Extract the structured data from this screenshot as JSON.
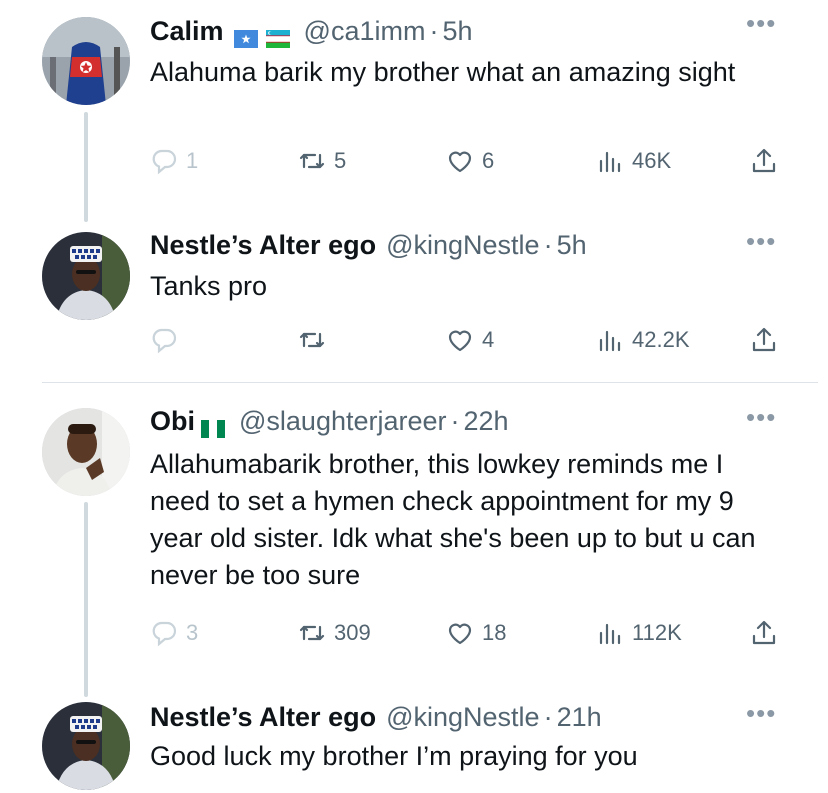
{
  "tweets": [
    {
      "name": "Calim",
      "handle": "@ca1imm",
      "sep": "·",
      "time": "5h",
      "text": "Alahuma barik my brother what an amazing sight",
      "replies": "1",
      "retweets": "5",
      "likes": "6",
      "views": "46K",
      "flags": [
        "somalia-flag",
        "uzbekistan-flag"
      ]
    },
    {
      "name": "Nestle’s Alter ego",
      "handle": "@kingNestle",
      "sep": "·",
      "time": "5h",
      "text": "Tanks pro",
      "replies": "",
      "retweets": "",
      "likes": "4",
      "views": "42.2K"
    },
    {
      "name": "Obi",
      "handle": "@slaughterjareer",
      "sep": "·",
      "time": "22h",
      "text": "Allahumabarik brother, this lowkey reminds me I need to set a hymen check appointment for my 9 year old sister. Idk what she's been up to but u can never be too sure",
      "replies": "3",
      "retweets": "309",
      "likes": "18",
      "views": "112K",
      "flags": [
        "nigeria-flag"
      ]
    },
    {
      "name": "Nestle’s Alter ego",
      "handle": "@kingNestle",
      "sep": "·",
      "time": "21h",
      "text": "Good luck my brother I’m praying for you"
    }
  ],
  "colors": {
    "text": "#0f1419",
    "secondary": "#536471",
    "thread_line": "#cfd9de",
    "flag_somalia": "#4189dd",
    "flag_nigeria": "#008751"
  }
}
